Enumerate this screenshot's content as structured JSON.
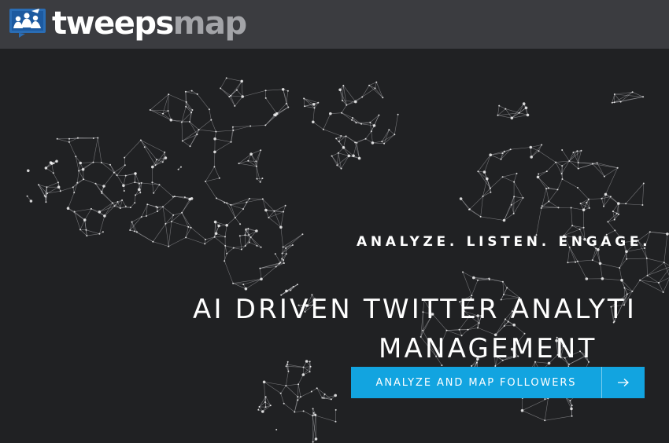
{
  "header": {
    "brand_name": {
      "primary": "tweeps",
      "secondary": "map"
    },
    "logo_icon": "people-on-monitor-icon",
    "background_color": "#3b3c40"
  },
  "hero": {
    "background_image": "world-network-map",
    "tagline": "ANALYZE. LISTEN. ENGAGE.",
    "headline_line1": "AI DRIVEN TWITTER ANALYTI",
    "headline_line2": "MANAGEMENT",
    "cta": {
      "label": "ANALYZE AND MAP FOLLOWERS",
      "icon": "arrow-right-icon",
      "color": "#12a4e0"
    }
  },
  "colors": {
    "page_background": "#202123",
    "brand_gray": "#a3a4a8",
    "map_lines": "#d8d8dc"
  }
}
